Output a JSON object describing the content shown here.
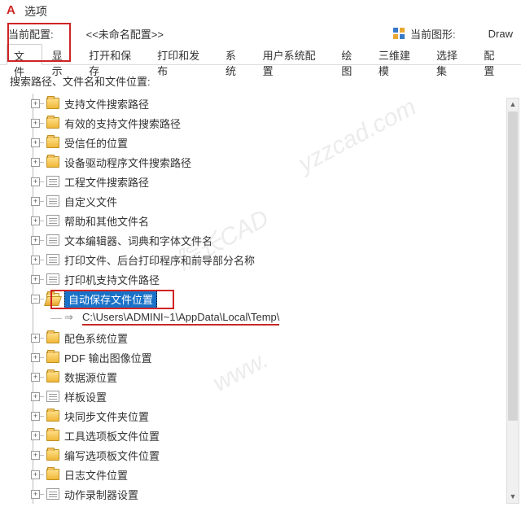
{
  "title": "选项",
  "profile": {
    "label": "当前配置:",
    "name": "<<未命名配置>>"
  },
  "drawing": {
    "label": "当前图形:",
    "name": "Draw"
  },
  "tabs": [
    "文件",
    "显示",
    "打开和保存",
    "打印和发布",
    "系统",
    "用户系统配置",
    "绘图",
    "三维建模",
    "选择集",
    "配置"
  ],
  "active_tab": 0,
  "section_label": "搜索路径、文件名和文件位置:",
  "tree": [
    {
      "label": "支持文件搜索路径",
      "icon": "folder-closed",
      "expander": "+"
    },
    {
      "label": "有效的支持文件搜索路径",
      "icon": "folder-closed",
      "expander": "+"
    },
    {
      "label": "受信任的位置",
      "icon": "folder-closed",
      "expander": "+"
    },
    {
      "label": "设备驱动程序文件搜索路径",
      "icon": "folder-closed",
      "expander": "+"
    },
    {
      "label": "工程文件搜索路径",
      "icon": "doc-icon",
      "expander": "+"
    },
    {
      "label": "自定义文件",
      "icon": "doc-icon",
      "expander": "+"
    },
    {
      "label": "帮助和其他文件名",
      "icon": "doc-icon",
      "expander": "+"
    },
    {
      "label": "文本编辑器、词典和字体文件名",
      "icon": "doc-icon",
      "expander": "+"
    },
    {
      "label": "打印文件、后台打印程序和前导部分名称",
      "icon": "doc-icon",
      "expander": "+"
    },
    {
      "label": "打印机支持文件路径",
      "icon": "doc-icon",
      "expander": "+"
    },
    {
      "label": "自动保存文件位置",
      "icon": "folder-open",
      "expander": "−",
      "selected": true,
      "children": [
        {
          "label": "C:\\Users\\ADMINI~1\\AppData\\Local\\Temp\\",
          "icon": "arrow-icon",
          "path": true
        }
      ]
    },
    {
      "label": "配色系统位置",
      "icon": "folder-closed",
      "expander": "+"
    },
    {
      "label": "PDF 输出图像位置",
      "icon": "folder-closed",
      "expander": "+"
    },
    {
      "label": "数据源位置",
      "icon": "folder-closed",
      "expander": "+"
    },
    {
      "label": "样板设置",
      "icon": "doc-icon",
      "expander": "+"
    },
    {
      "label": "块同步文件夹位置",
      "icon": "folder-closed",
      "expander": "+"
    },
    {
      "label": "工具选项板文件位置",
      "icon": "folder-closed",
      "expander": "+"
    },
    {
      "label": "编写选项板文件位置",
      "icon": "folder-closed",
      "expander": "+"
    },
    {
      "label": "日志文件位置",
      "icon": "folder-closed",
      "expander": "+"
    },
    {
      "label": "动作录制器设置",
      "icon": "doc-icon",
      "expander": "+"
    }
  ],
  "watermarks": [
    "院长CAD",
    "yzzcad.com",
    "www."
  ]
}
